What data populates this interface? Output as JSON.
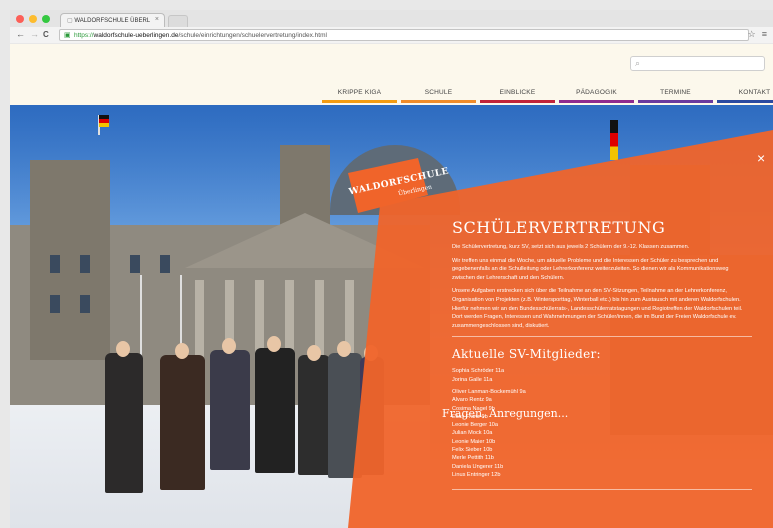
{
  "browser": {
    "tab_title": "WALDORFSCHULE ÜBERL",
    "tab_close": "×",
    "url_scheme": "https://",
    "url_host": "waldorfschule-ueberlingen.de",
    "url_path": "/schule/einrichtungen/schuelervertretung/index.html",
    "back": "←",
    "forward": "→",
    "reload": "C",
    "lock": "🔒",
    "star": "☆",
    "menu": "≡"
  },
  "search": {
    "placeholder": "",
    "icon": "search-icon"
  },
  "nav": {
    "items": [
      {
        "label": "KRIPPE  KIGA",
        "color": "#f39c12"
      },
      {
        "label": "SCHULE",
        "color": "#f08c2a"
      },
      {
        "label": "EINBLICKE",
        "color": "#c2243a"
      },
      {
        "label": "PÄDAGOGIK",
        "color": "#8e2a8e"
      },
      {
        "label": "TERMINE",
        "color": "#6a3a9e"
      },
      {
        "label": "KONTAKT",
        "color": "#2a4aa0"
      }
    ]
  },
  "logo": {
    "name": "WALDORFSCHULE",
    "town": "Überlingen"
  },
  "overlay": {
    "color": "#f0642a",
    "close": "×",
    "title": "SCHÜLERVERTRETUNG",
    "paragraphs": [
      "Die Schülervertretung, kurz SV, setzt sich aus jeweils 2 Schülern der 9.-12. Klassen zusammen.",
      "Wir treffen uns einmal die Woche, um aktuelle Probleme und die Interessen der Schüler zu besprechen und gegebenenfalls an die Schulleitung oder Lehrerkonferenz weiterzuleiten. So dienen wir als Kommunikationsweg zwischen der Lehrerschaft und den Schülern.",
      "Unsere Aufgaben erstrecken sich über die Teilnahme an den SV-Sitzungen, Teilnahme an der Lehrerkonferenz, Organisation von Projekten (z.B. Wintersporttag, Winterball etc.) bis hin zum Austausch mit anderen Waldorfschulen. Hierfür nehmen wir an den Bundesschülerrats-, Landesschülerratstagungen und Regiotreffen der Waldorfschulen teil. Dort werden Fragen, Interessen und Wahrnehmungen der Schüler/innen, die im Bund der Freien Waldorfschule ev. zusammengeschlossen sind, diskutiert."
    ],
    "members_heading": "Aktuelle SV-Mitglieder:",
    "members_group1": [
      "Sophia Schröder 11a",
      "Jorina Galle 11a"
    ],
    "members_group2": [
      "Oliver Lanman-Bockemühl 9a",
      "Alvaro Rentz 9a",
      "Cosima Nagel 9b",
      "Elias Franz 9b",
      "Leonie Berger 10a",
      "Julian Mock 10a",
      "Leonie Maier 10b",
      "Felix Sieber 10b",
      "Merle Pettith 11b",
      "Daniela Ungerer 11b",
      "Linus Entringer 12b"
    ],
    "next_heading": "Fragen, Anregungen..."
  }
}
